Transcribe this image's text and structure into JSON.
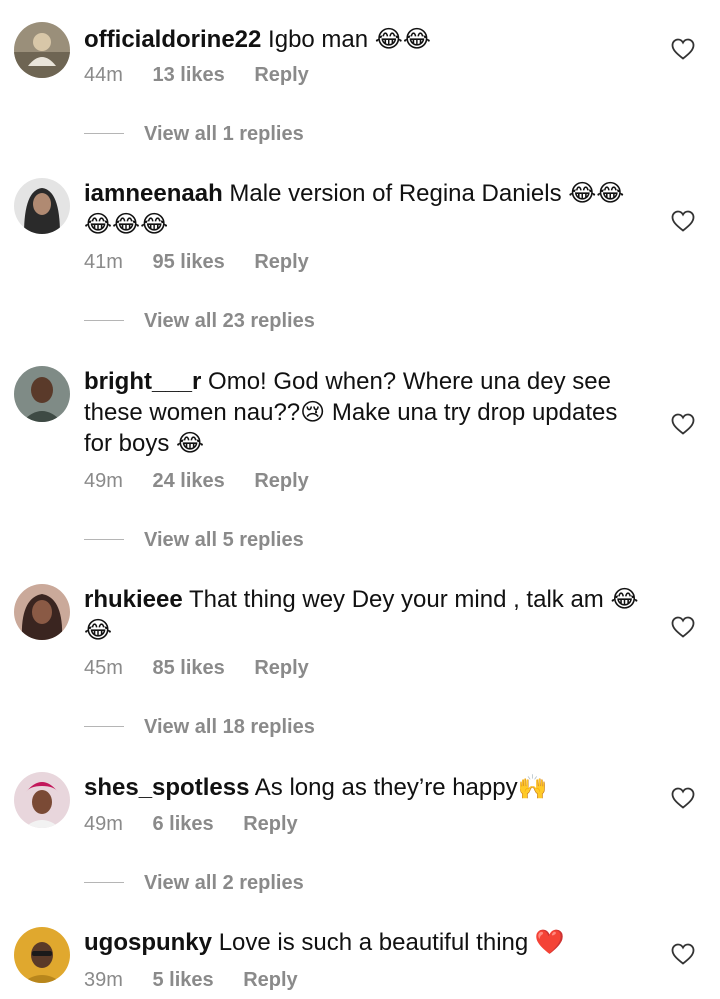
{
  "comments": [
    {
      "username": "officialdorine22",
      "text": "Igbo man 😂😂",
      "time": "44m",
      "likes": "13 likes",
      "reply_label": "Reply",
      "view_replies": "View all 1 replies"
    },
    {
      "username": "iamneenaah",
      "text": "Male version of Regina Daniels 😂😂 😂😂😂",
      "time": "41m",
      "likes": "95 likes",
      "reply_label": "Reply",
      "view_replies": "View all 23 replies"
    },
    {
      "username": "bright___r",
      "text": "Omo! God when? Where una dey see these women nau??😢 Make una try drop updates for boys 😂",
      "time": "49m",
      "likes": "24 likes",
      "reply_label": "Reply",
      "view_replies": "View all 5 replies"
    },
    {
      "username": "rhukieee",
      "text": "That thing wey Dey your mind , talk am 😂 😂",
      "time": "45m",
      "likes": "85 likes",
      "reply_label": "Reply",
      "view_replies": "View all 18 replies"
    },
    {
      "username": "shes_spotless",
      "text": "As long as they’re happy🙌",
      "time": "49m",
      "likes": "6 likes",
      "reply_label": "Reply",
      "view_replies": "View all 2 replies"
    },
    {
      "username": "ugospunky",
      "text": "Love is such a beautiful thing ❤️",
      "time": "39m",
      "likes": "5 likes",
      "reply_label": "Reply"
    }
  ],
  "icons": {
    "like": "heart-outline-icon"
  },
  "colors": {
    "text": "#111111",
    "muted": "#8a8a8a",
    "divider": "#b5b5b5",
    "heart_stroke": "#333333"
  }
}
